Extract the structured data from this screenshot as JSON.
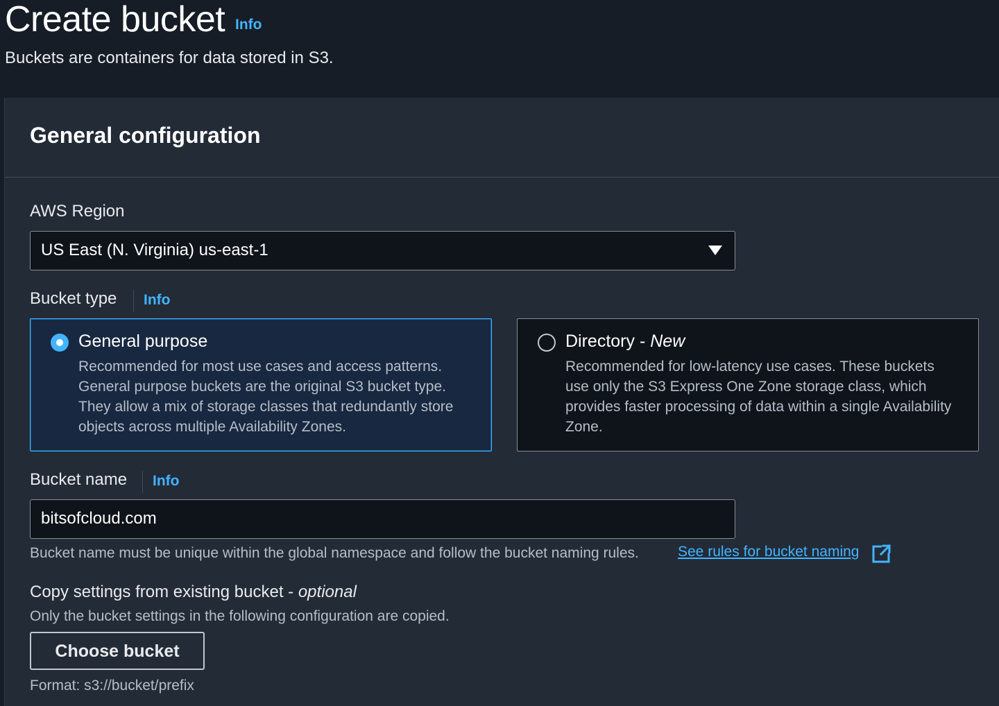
{
  "header": {
    "title": "Create bucket",
    "info": "Info",
    "description": "Buckets are containers for data stored in S3."
  },
  "general_config": {
    "title": "General configuration",
    "region": {
      "label": "AWS Region",
      "value": "US East (N. Virginia) us-east-1"
    },
    "bucket_type": {
      "label": "Bucket type",
      "info": "Info",
      "options": [
        {
          "title": "General purpose",
          "selected": true,
          "description": "Recommended for most use cases and access patterns. General purpose buckets are the original S3 bucket type. They allow a mix of storage classes that redundantly store objects across multiple Availability Zones."
        },
        {
          "title_prefix": "Directory - ",
          "title_badge": "New",
          "selected": false,
          "description": "Recommended for low-latency use cases. These buckets use only the S3 Express One Zone storage class, which provides faster processing of data within a single Availability Zone."
        }
      ]
    },
    "bucket_name": {
      "label": "Bucket name",
      "info": "Info",
      "value": "bitsofcloud.com",
      "hint": "Bucket name must be unique within the global namespace and follow the bucket naming rules.",
      "link": "See rules for bucket naming",
      "link_icon": "external-link-icon"
    },
    "copy_settings": {
      "label_prefix": "Copy settings from existing bucket - ",
      "label_optional": "optional",
      "description": "Only the bucket settings in the following configuration are copied.",
      "button": "Choose bucket",
      "format_hint": "Format: s3://bucket/prefix"
    }
  },
  "colors": {
    "background": "#161d26",
    "panel": "#232b37",
    "accent": "#42b4ff",
    "selected_tile": "#182840"
  }
}
